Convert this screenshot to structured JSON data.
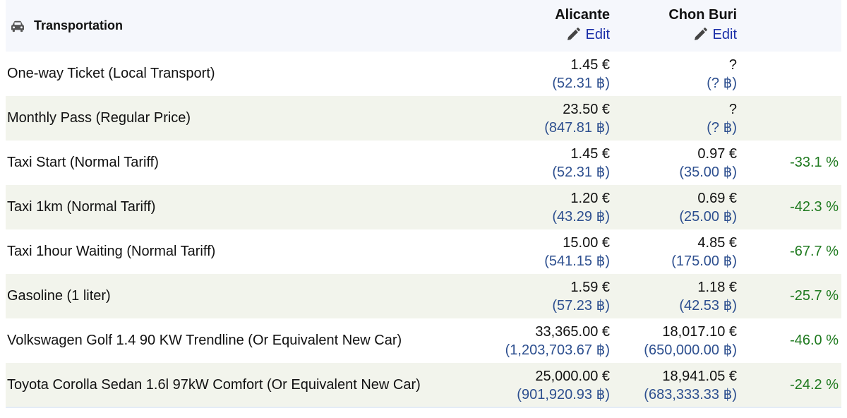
{
  "category": {
    "label": "Transportation",
    "icon": "car-icon"
  },
  "cities": [
    {
      "name": "Alicante",
      "edit_label": "Edit"
    },
    {
      "name": "Chon Buri",
      "edit_label": "Edit"
    }
  ],
  "rows": [
    {
      "item": "One-way Ticket (Local Transport)",
      "c1_eur": "1.45 €",
      "c1_thb": "(52.31 ฿)",
      "c2_eur": "?",
      "c2_thb": "(? ฿)",
      "diff": ""
    },
    {
      "item": "Monthly Pass (Regular Price)",
      "c1_eur": "23.50 €",
      "c1_thb": "(847.81 ฿)",
      "c2_eur": "?",
      "c2_thb": "(? ฿)",
      "diff": ""
    },
    {
      "item": "Taxi Start (Normal Tariff)",
      "c1_eur": "1.45 €",
      "c1_thb": "(52.31 ฿)",
      "c2_eur": "0.97 €",
      "c2_thb": "(35.00 ฿)",
      "diff": "-33.1 %"
    },
    {
      "item": "Taxi 1km (Normal Tariff)",
      "c1_eur": "1.20 €",
      "c1_thb": "(43.29 ฿)",
      "c2_eur": "0.69 €",
      "c2_thb": "(25.00 ฿)",
      "diff": "-42.3 %"
    },
    {
      "item": "Taxi 1hour Waiting (Normal Tariff)",
      "c1_eur": "15.00 €",
      "c1_thb": "(541.15 ฿)",
      "c2_eur": "4.85 €",
      "c2_thb": "(175.00 ฿)",
      "diff": "-67.7 %"
    },
    {
      "item": "Gasoline (1 liter)",
      "c1_eur": "1.59 €",
      "c1_thb": "(57.23 ฿)",
      "c2_eur": "1.18 €",
      "c2_thb": "(42.53 ฿)",
      "diff": "-25.7 %"
    },
    {
      "item": "Volkswagen Golf 1.4 90 KW Trendline (Or Equivalent New Car)",
      "c1_eur": "33,365.00 €",
      "c1_thb": "(1,203,703.67 ฿)",
      "c2_eur": "18,017.10 €",
      "c2_thb": "(650,000.00 ฿)",
      "diff": "-46.0 %"
    },
    {
      "item": "Toyota Corolla Sedan 1.6l 97kW Comfort (Or Equivalent New Car)",
      "c1_eur": "25,000.00 €",
      "c1_thb": "(901,920.93 ฿)",
      "c2_eur": "18,941.05 €",
      "c2_thb": "(683,333.33 ฿)",
      "diff": "-24.2 %"
    }
  ],
  "colors": {
    "link": "#1a2ea8",
    "thb": "#2d4f8f",
    "diff": "#1f7a1f",
    "stripe": "#f2f4ec"
  }
}
